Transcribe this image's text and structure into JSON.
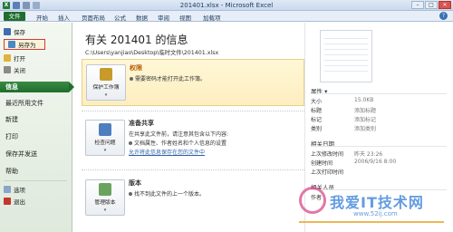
{
  "window": {
    "title": "201401.xlsx - Microsoft Excel",
    "app_icon": "X",
    "minimize": "–",
    "maximize": "□",
    "close": "✕"
  },
  "ribbon_tabs": [
    "文件",
    "开始",
    "插入",
    "页面布局",
    "公式",
    "数据",
    "审阅",
    "视图",
    "加载项"
  ],
  "help_icon": "?",
  "nav": {
    "save": "保存",
    "save_as": "另存为",
    "open": "打开",
    "close": "关闭",
    "info": "信息",
    "recent": "最近所用文件",
    "new": "新建",
    "print": "打印",
    "save_send": "保存并发送",
    "help": "帮助",
    "options": "选项",
    "exit": "退出"
  },
  "info": {
    "title": "有关 201401 的信息",
    "path": "C:\\Users\\yanjiao\\Desktop\\临时文件\\201401.xlsx",
    "permissions": {
      "button": "保护工作簿",
      "heading": "权限",
      "text": "需要密码才能打开此工作簿。"
    },
    "prepare": {
      "button": "检查问题",
      "heading": "准备共享",
      "text": "在共享此文件前，请注意其包含以下内容:",
      "bullet": "文档属性、作者姓名和个人信息的设置",
      "link": "允许将此信息保存在您的文件中"
    },
    "versions": {
      "button": "管理版本",
      "heading": "版本",
      "text": "找不到此文件的上一个版本。"
    }
  },
  "properties": {
    "heading": "属性 ▾",
    "rows": [
      {
        "k": "大小",
        "v": "15.0KB"
      },
      {
        "k": "标题",
        "v": "添加标题"
      },
      {
        "k": "标记",
        "v": "添加标记"
      },
      {
        "k": "类别",
        "v": "添加类别"
      }
    ],
    "dates_heading": "相关日期",
    "dates": [
      {
        "k": "上次修改时间",
        "v": "昨天 23:26"
      },
      {
        "k": "创建时间",
        "v": "2006/9/16 8:00"
      },
      {
        "k": "上次打印时间",
        "v": ""
      }
    ],
    "people_heading": "相关人员",
    "people": [
      {
        "k": "作者",
        "v": ""
      }
    ]
  },
  "watermark": {
    "text": "我爱IT技术网",
    "url": "www.52ij.com"
  },
  "colors": {
    "file_tab": "#1f6e2e",
    "active_nav": "#2a7a36",
    "highlight_border": "#d23a3a",
    "link": "#2f62a5"
  }
}
